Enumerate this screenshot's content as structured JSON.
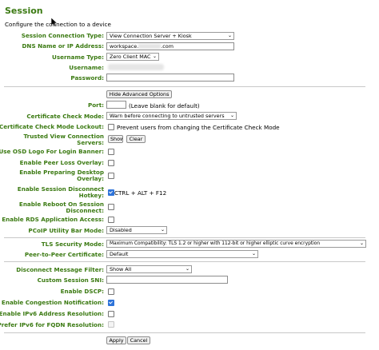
{
  "page": {
    "title": "Session",
    "subtitle": "Configure the connection to a device"
  },
  "form": {
    "session_type": {
      "label": "Session Connection Type:",
      "value": "View Connection Server + Kiosk"
    },
    "dns": {
      "label": "DNS Name or IP Address:",
      "value_prefix": "workspace.",
      "value_suffix": ".com"
    },
    "username_type": {
      "label": "Username Type:",
      "value": "Zero Client MAC"
    },
    "username": {
      "label": "Username:"
    },
    "password": {
      "label": "Password:"
    },
    "advanced_button": "Hide Advanced Options",
    "port": {
      "label": "Port:",
      "hint": "(Leave blank for default)"
    },
    "cert_check_mode": {
      "label": "Certificate Check Mode:",
      "value": "Warn before connecting to untrusted servers"
    },
    "cert_lockout": {
      "label": "Certificate Check Mode Lockout:",
      "text": "Prevent users from changing the Certificate Check Mode",
      "checked": false
    },
    "trusted_servers": {
      "label": "Trusted View Connection Servers:",
      "show": "Show",
      "clear": "Clear"
    },
    "osd_logo": {
      "label": "Use OSD Logo For Login Banner:",
      "checked": false
    },
    "peer_loss": {
      "label": "Enable Peer Loss Overlay:",
      "checked": false
    },
    "preparing_desktop": {
      "label": "Enable Preparing Desktop Overlay:",
      "checked": false
    },
    "disconnect_hotkey": {
      "label": "Enable Session Disconnect Hotkey:",
      "text": "CTRL + ALT + F12",
      "checked": true
    },
    "reboot_disconnect": {
      "label": "Enable Reboot On Session Disconnect:",
      "checked": false
    },
    "rds_access": {
      "label": "Enable RDS Application Access:",
      "checked": false
    },
    "utility_bar": {
      "label": "PCoIP Utility Bar Mode:",
      "value": "Disabled"
    },
    "tls_mode": {
      "label": "TLS Security Mode:",
      "value": "Maximum Compatibility: TLS 1.2 or higher with 112-bit or higher elliptic curve encryption"
    },
    "peer_cert": {
      "label": "Peer-to-Peer Certificate:",
      "value": "Default"
    },
    "disconnect_filter": {
      "label": "Disconnect Message Filter:",
      "value": "Show All"
    },
    "custom_sni": {
      "label": "Custom Session SNI:"
    },
    "dscp": {
      "label": "Enable DSCP:",
      "checked": false
    },
    "congestion": {
      "label": "Enable Congestion Notification:",
      "checked": true
    },
    "ipv6_resolution": {
      "label": "Enable IPv6 Address Resolution:",
      "checked": false
    },
    "prefer_ipv6": {
      "label": "Prefer IPv6 for FQDN Resolution:",
      "checked": false
    }
  },
  "actions": {
    "apply": "Apply",
    "cancel": "Cancel"
  },
  "icons": {
    "cursor": "mouse-pointer-icon",
    "dropdown": "chevron-down-icon",
    "check": "checkmark-icon"
  }
}
